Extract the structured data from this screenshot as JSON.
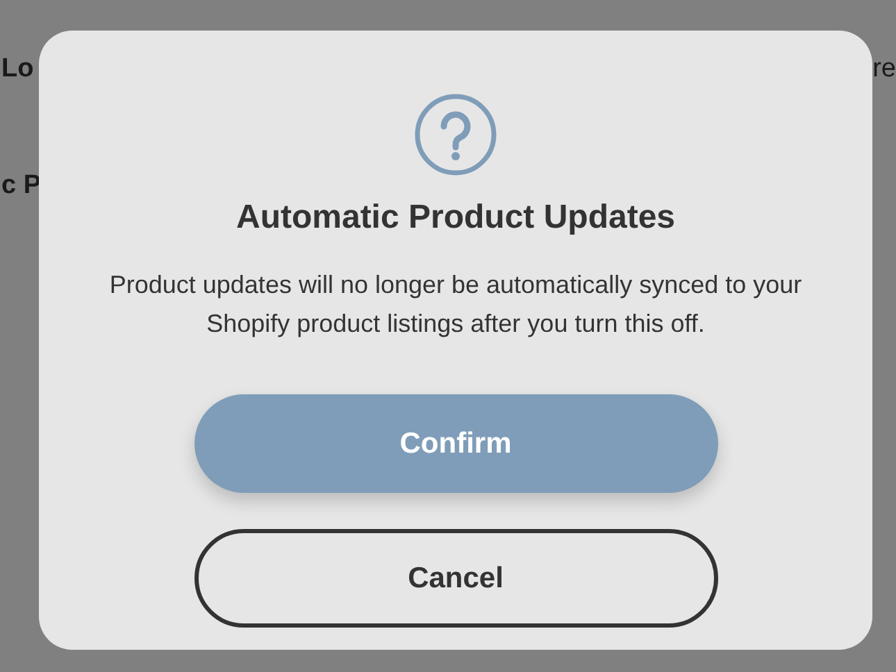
{
  "background": {
    "left_texts": [
      "Lo",
      "c P"
    ],
    "right_text": "re"
  },
  "dialog": {
    "title": "Automatic Product Updates",
    "message": "Product updates will no longer be automatically synced to your Shopify product listings after you turn this off.",
    "buttons": [
      {
        "label": "Confirm",
        "kind": "primary"
      },
      {
        "label": "Cancel",
        "kind": "secondary"
      }
    ]
  }
}
